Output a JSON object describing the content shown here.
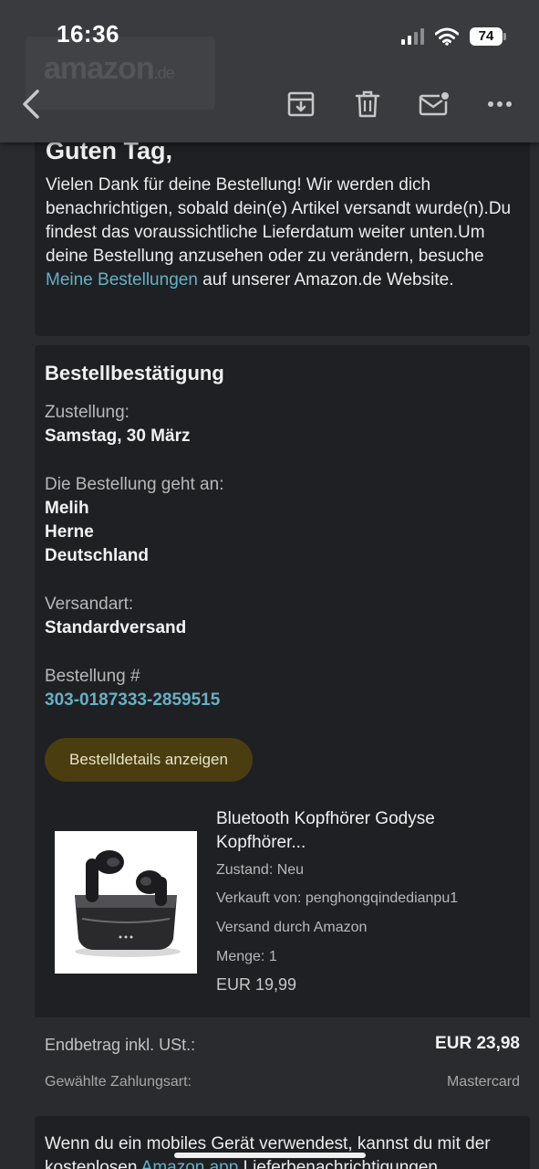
{
  "status": {
    "time": "16:36",
    "battery": "74"
  },
  "logo": {
    "text": "amazon",
    "tld": ".de"
  },
  "greeting": {
    "title": "Guten Tag,",
    "text_before_link": "Vielen Dank für deine Bestellung! Wir werden dich benachrichtigen, sobald dein(e) Artikel versandt wurde(n).Du findest das voraussichtliche Lieferdatum weiter unten.Um deine Bestellung anzusehen oder zu verändern, besuche ",
    "link": "Meine Bestellungen",
    "text_after_link": " auf unserer Amazon.de Website."
  },
  "order": {
    "title": "Bestellbestätigung",
    "delivery_label": "Zustellung:",
    "delivery_value": "Samstag, 30 März",
    "shipto_label": "Die Bestellung geht an:",
    "shipto_name": "Melih",
    "shipto_city": "Herne",
    "shipto_country": "Deutschland",
    "shipping_label": "Versandart:",
    "shipping_value": "Standardversand",
    "number_label": "Bestellung #",
    "number_value": "303-0187333-2859515",
    "details_button": "Bestelldetails anzeigen"
  },
  "product": {
    "title": "Bluetooth Kopfhörer Godyse Kopfhörer...",
    "condition": "Zustand: Neu",
    "seller": "Verkauft von: penghongqindedianpu1",
    "fulfillment": "Versand durch Amazon",
    "quantity": "Menge: 1",
    "price": "EUR 19,99"
  },
  "totals": {
    "total_label": "Endbetrag inkl. USt.:",
    "total_value": "EUR 23,98",
    "payment_label": "Gewählte Zahlungsart:",
    "payment_value": "Mastercard"
  },
  "footer": {
    "text_before_link": "Wenn du ein mobiles Gerät verwendest, kannst du mit der kostenlosen ",
    "link": "Amazon app",
    "text_after_link": " Lieferbenachrichtigungen"
  },
  "colors": {
    "link": "#67b0c4",
    "button_bg": "#4a3d10",
    "card_bg": "#1f2024",
    "page_bg": "#2a2b2f"
  }
}
